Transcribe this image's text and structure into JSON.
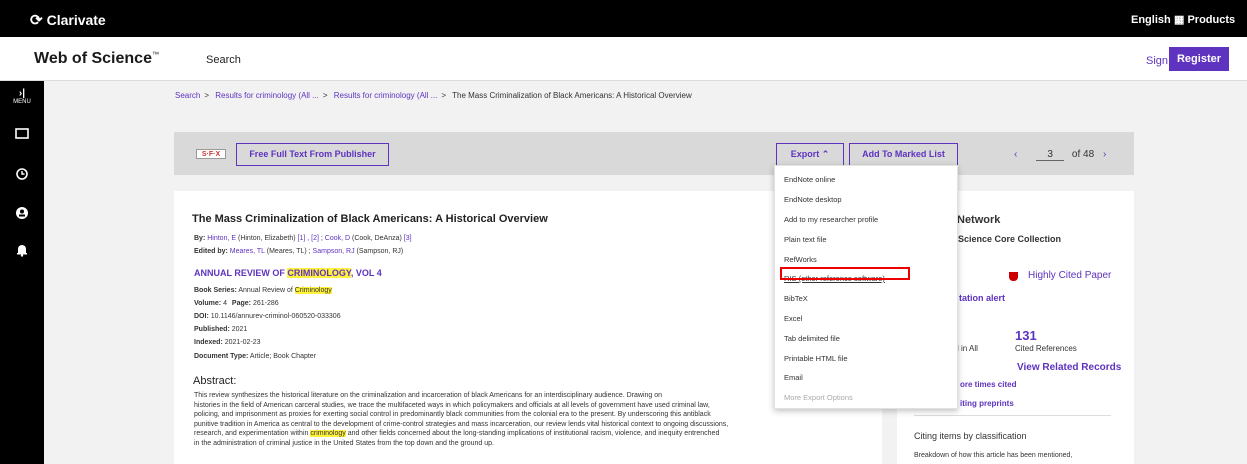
{
  "topbar": {
    "brand": "Clarivate",
    "language": "English ⌄",
    "products": "▦ Products"
  },
  "header": {
    "product_name": "Web of Science",
    "product_tm": "™",
    "search_link": "Search",
    "sign_in": "Sign In ⌄",
    "register": "Register"
  },
  "leftnav": {
    "menu_label_1": "›|",
    "menu_label_2": "MENU",
    "items": [
      "folder-icon",
      "history-icon",
      "account-icon",
      "bell-icon"
    ]
  },
  "breadcrumb": {
    "items": [
      "Search",
      "Results for criminology (All ...",
      "Results for criminology (All ..."
    ],
    "current": "The Mass Criminalization of Black Americans: A Historical Overview",
    "separator": ">"
  },
  "actionbar": {
    "sfx_label": "S·F·X",
    "full_text": "Free Full Text From Publisher",
    "export": "Export ⌃",
    "add_marked": "Add To Marked List",
    "prev": "‹",
    "page": "3",
    "of_total": "of 48",
    "next": "›"
  },
  "record": {
    "title": "The Mass Criminalization of Black Americans: A Historical Overview",
    "by_label": "By:",
    "author1_link": "Hinton, E",
    "author1_full": "(Hinton, Elizabeth)",
    "author1_refs": "[1] , [2]",
    "author2_link": "Cook, D",
    "author2_full": "(Cook, DeAnza)",
    "author2_refs": "[3]",
    "edited_label": "Edited by:",
    "editor1_link": "Meares, TL",
    "editor1_full": "(Meares, TL)",
    "editor2_link": "Sampson, RJ",
    "editor2_full": "(Sampson, RJ)",
    "journal_prefix": "ANNUAL REVIEW OF",
    "journal_hl": "CRIMINOLOGY",
    "journal_suffix": ", VOL 4",
    "book_series_label": "Book Series:",
    "book_series_prefix": "Annual Review of",
    "book_series_hl": "Criminology",
    "volume_label": "Volume:",
    "volume": "4",
    "page_label": "Page:",
    "pages": "261-286",
    "doi_label": "DOI:",
    "doi": "10.1146/annurev-criminol-060520-033306",
    "published_label": "Published:",
    "published": "2021",
    "indexed_label": "Indexed:",
    "indexed": "2021-02-23",
    "doctype_label": "Document Type:",
    "doctype": "Article; Book Chapter",
    "abstract_heading": "Abstract:",
    "abstract_1": "This review synthesizes the historical literature on the criminalization and incarceration of black Americans for an interdisciplinary audience. Drawing on",
    "abstract_2": "histories in the field of American carceral studies, we trace the multifaceted ways in which policymakers and officials at all levels of government have used criminal law,",
    "abstract_3": "policing, and imprisonment as proxies for exerting social control in predominantly black communities from the colonial era to the present. By underscoring this antiblack",
    "abstract_4": "punitive tradition in America as central to the development of crime-control strategies and mass incarceration, our review lends vital historical context to ongoing discussions,",
    "abstract_5_pre": "research, and experimentation within",
    "abstract_5_hl": "criminology",
    "abstract_5_post": "and other fields concerned about the long-standing implications of institutional racism, violence, and inequity entrenched",
    "abstract_6": "in the administration of criminal justice in the United States from the top down and the ground up."
  },
  "citation_panel": {
    "network": "Network",
    "core": "Science Core Collection",
    "highly_cited": "Highly Cited Paper",
    "alert": "tation alert",
    "cited_refs_count": "131",
    "in_all": "l in All",
    "cited_refs": "Cited References",
    "related": "View Related Records",
    "more_cited": "ore times cited",
    "preprints": "iting preprints",
    "classification": "Citing items by classification",
    "breakdown": "Breakdown of how this article has been mentioned,"
  },
  "export_menu": {
    "items": [
      "EndNote online",
      "EndNote desktop",
      "Add to my researcher profile",
      "Plain text file",
      "RefWorks",
      "RIS (other reference software)",
      "BibTeX",
      "Excel",
      "Tab delimited file",
      "Printable HTML file",
      "Email"
    ],
    "more": "More Export Options"
  },
  "colors": {
    "accent": "#5e33bf",
    "highlight": "#fff23d",
    "callout": "#ee0000"
  }
}
